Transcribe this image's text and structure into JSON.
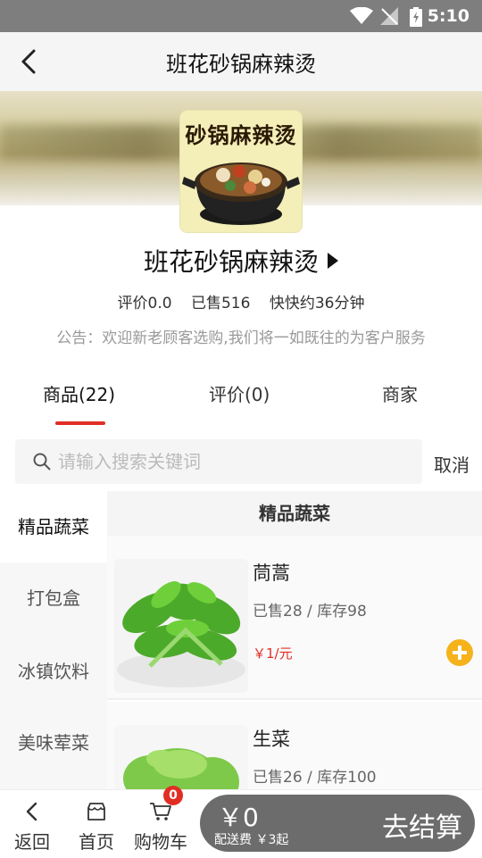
{
  "status_bar": {
    "time": "5:10"
  },
  "header": {
    "title": "班花砂锅麻辣烫"
  },
  "shop": {
    "logo_text": "砂锅麻辣烫",
    "name": "班花砂锅麻辣烫",
    "rating": "评价0.0",
    "sold": "已售516",
    "delivery": "快快约36分钟",
    "notice": "公告：欢迎新老顾客选购,我们将一如既往的为客户服务"
  },
  "tabs": [
    {
      "label": "商品(22)",
      "active": true
    },
    {
      "label": "评价(0)",
      "active": false
    },
    {
      "label": "商家",
      "active": false
    }
  ],
  "search": {
    "placeholder": "请输入搜索关键词",
    "cancel_label": "取消"
  },
  "categories": [
    {
      "label": "精品蔬菜",
      "active": true
    },
    {
      "label": "打包盒",
      "active": false
    },
    {
      "label": "冰镇饮料",
      "active": false
    },
    {
      "label": "美味荤菜",
      "active": false
    }
  ],
  "section_title": "精品蔬菜",
  "items": [
    {
      "name": "茼蒿",
      "sold_stock": "已售28 / 库存98",
      "price": "￥1/元"
    },
    {
      "name": "生菜",
      "sold_stock": "已售26 / 库存100",
      "price": ""
    }
  ],
  "bottom_nav": [
    {
      "label": "返回",
      "icon": "chevron-left-icon"
    },
    {
      "label": "首页",
      "icon": "store-icon"
    },
    {
      "label": "购物车",
      "icon": "cart-icon"
    }
  ],
  "cart": {
    "badge_count": "0",
    "total": "￥0",
    "delivery_fee": "配送费 ￥3起",
    "checkout_label": "去结算"
  },
  "colors": {
    "accent": "#e02e24",
    "add_button": "#f5b21b",
    "checkout_bg": "#6c6c6c",
    "status_bar": "#7e7e7e"
  }
}
